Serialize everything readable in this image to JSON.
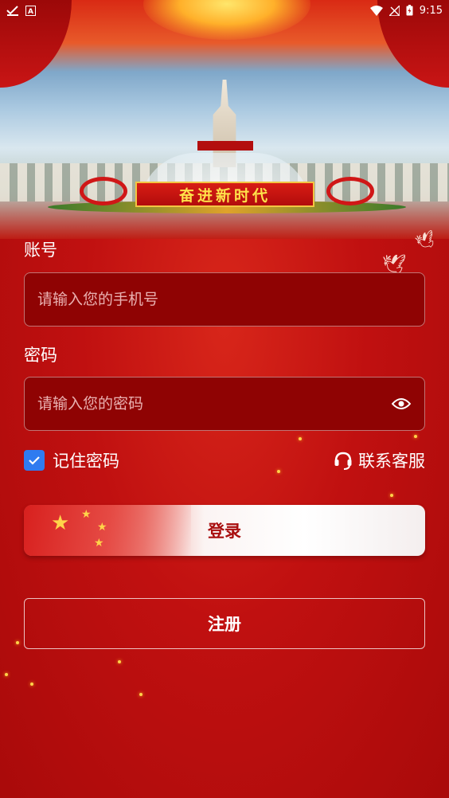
{
  "status_bar": {
    "time": "9:15",
    "left_icons": [
      "checkmark-notification-icon",
      "a-box-notification-icon"
    ],
    "right_icons": [
      "wifi-icon",
      "no-signal-icon",
      "battery-charging-icon"
    ]
  },
  "banner": {
    "slogan": "奋进新时代"
  },
  "account": {
    "label": "账号",
    "placeholder": "请输入您的手机号",
    "value": ""
  },
  "password": {
    "label": "密码",
    "placeholder": "请输入您的密码",
    "value": "",
    "toggle_icon": "eye-icon"
  },
  "remember": {
    "label": "记住密码",
    "checked": true
  },
  "support": {
    "label": "联系客服",
    "icon": "headset-icon"
  },
  "actions": {
    "login_label": "登录",
    "register_label": "注册"
  },
  "colors": {
    "background": "#b80d0d",
    "input_bg": "#8f0303",
    "checkbox": "#2f7bf0",
    "login_text": "#a90f0f"
  }
}
